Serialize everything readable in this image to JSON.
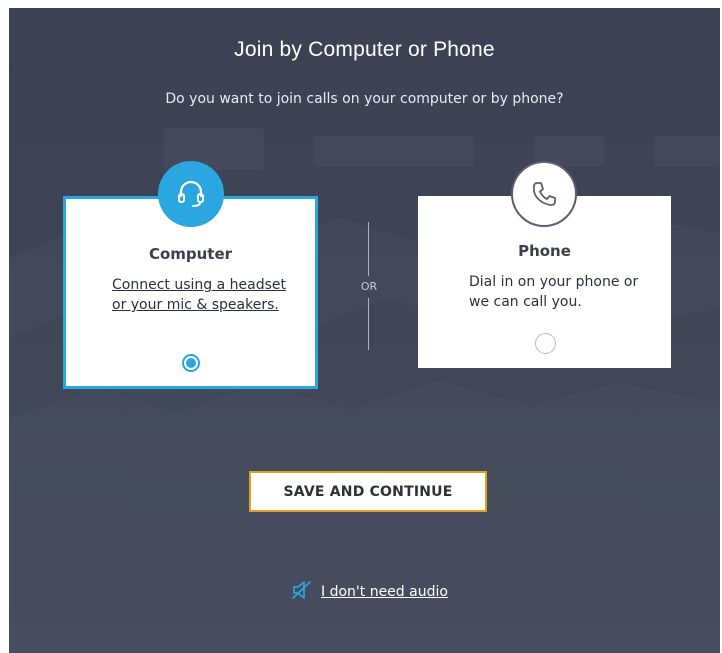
{
  "dialog": {
    "title": "Join by Computer or Phone",
    "subtitle": "Do you want to join calls on your computer or by phone?"
  },
  "options": {
    "computer": {
      "title": "Computer",
      "description": "Connect using a headset or your mic & speakers.",
      "icon": "headset-icon",
      "selected": true
    },
    "phone": {
      "title": "Phone",
      "description": "Dial in on your phone or we can call you.",
      "icon": "phone-icon",
      "selected": false
    },
    "separator": "OR"
  },
  "actions": {
    "save_label": "SAVE AND CONTINUE",
    "no_audio_label": "I don't need audio",
    "no_audio_icon": "speaker-muted-icon"
  },
  "colors": {
    "accent_blue": "#2aa6e0",
    "button_border": "#e0a020",
    "background": "#3f4557"
  }
}
